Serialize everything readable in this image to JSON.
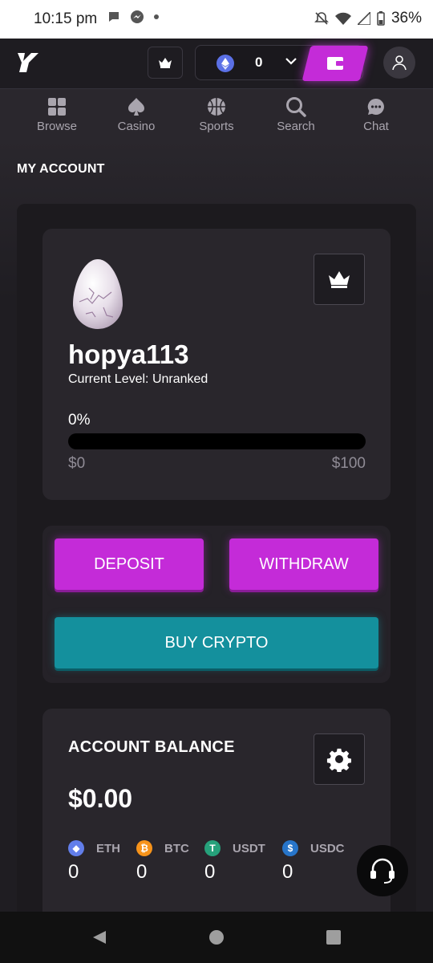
{
  "status_bar": {
    "time": "10:15 pm",
    "battery": "36%"
  },
  "header": {
    "wallet_amount": "0"
  },
  "nav": [
    {
      "label": "Browse"
    },
    {
      "label": "Casino"
    },
    {
      "label": "Sports"
    },
    {
      "label": "Search"
    },
    {
      "label": "Chat"
    }
  ],
  "page": {
    "title": "MY ACCOUNT"
  },
  "profile": {
    "username": "hopya113",
    "level": "Current Level: Unranked",
    "progress_label": "0%",
    "progress_value": 0,
    "progress_min": "$0",
    "progress_max": "$100"
  },
  "actions": {
    "deposit": "DEPOSIT",
    "withdraw": "WITHDRAW",
    "buy_crypto": "BUY CRYPTO"
  },
  "balance": {
    "title": "ACCOUNT BALANCE",
    "total": "$0.00",
    "coins": [
      {
        "symbol": "ETH",
        "amount": "0",
        "color": "#627eea"
      },
      {
        "symbol": "BTC",
        "amount": "0",
        "color": "#f7931a"
      },
      {
        "symbol": "USDT",
        "amount": "0",
        "color": "#26a17b"
      },
      {
        "symbol": "USDC",
        "amount": "0",
        "color": "#2775ca"
      }
    ]
  },
  "colors": {
    "accent": "#c42bd8",
    "teal": "#14909d"
  }
}
